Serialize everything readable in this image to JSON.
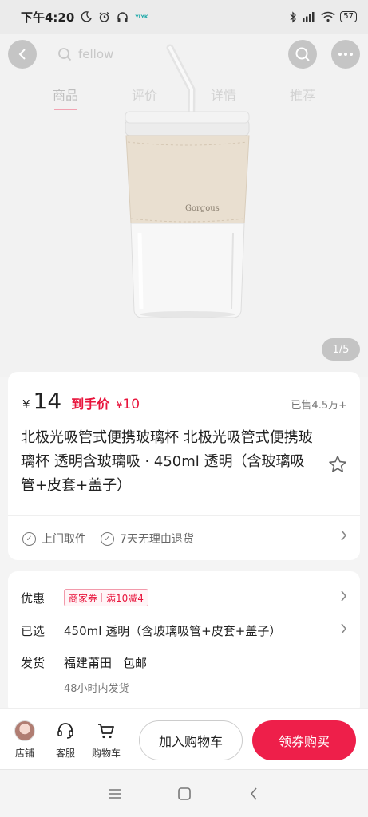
{
  "status_bar": {
    "time": "下午4:20",
    "app_badge": "YLYK",
    "battery": "57"
  },
  "header": {
    "search_placeholder": "fellow",
    "tabs": [
      "商品",
      "评价",
      "详情",
      "推荐"
    ],
    "active_tab": "商品"
  },
  "gallery": {
    "counter": "1/5",
    "sleeve_brand": "Gorgous"
  },
  "product": {
    "currency": "¥",
    "price": "14",
    "final_label": "到手价",
    "final_currency": "¥",
    "final_price": "10",
    "sold": "已售4.5万+",
    "title": "北极光吸管式便携玻璃杯 北极光吸管式便携玻璃杯 透明含玻璃吸 · 450ml 透明（含玻璃吸管+皮套+盖子）"
  },
  "services": {
    "items": [
      "上门取件",
      "7天无理由退货"
    ]
  },
  "details": {
    "discount_label": "优惠",
    "coupon_type": "商家券",
    "coupon_value": "满10减4",
    "selected_label": "已选",
    "selected_value": "450ml 透明（含玻璃吸管+皮套+盖子）",
    "shipping_label": "发货",
    "shipping_from": "福建莆田",
    "shipping_free": "包邮",
    "shipping_time": "48小时内发货"
  },
  "bottom_bar": {
    "shop": "店铺",
    "service": "客服",
    "cart": "购物车",
    "add_to_cart": "加入购物车",
    "buy": "领券购买"
  },
  "colors": {
    "accent": "#ee1f4a",
    "price_red": "#e8143c"
  }
}
